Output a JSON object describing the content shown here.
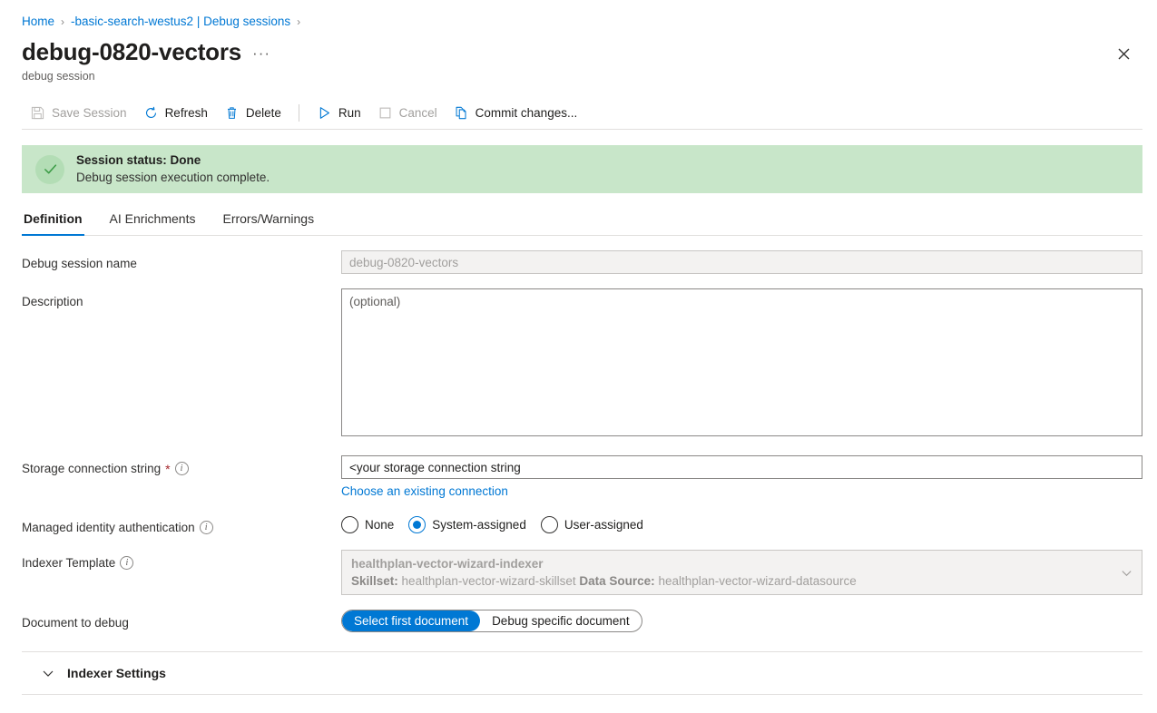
{
  "breadcrumb": {
    "items": [
      {
        "label": "Home"
      },
      {
        "label": "-basic-search-westus2 | Debug sessions"
      }
    ],
    "separator": "›"
  },
  "header": {
    "title": "debug-0820-vectors",
    "ellipsis": "···",
    "subtitle": "debug session",
    "close_label": "Close"
  },
  "toolbar": {
    "save_label": "Save Session",
    "refresh_label": "Refresh",
    "delete_label": "Delete",
    "run_label": "Run",
    "cancel_label": "Cancel",
    "commit_label": "Commit changes..."
  },
  "status": {
    "title": "Session status: Done",
    "description": "Debug session execution complete.",
    "bg_color": "#c8e6c9",
    "icon_color": "#107c10"
  },
  "tabs": [
    {
      "label": "Definition",
      "active": true
    },
    {
      "label": "AI Enrichments",
      "active": false
    },
    {
      "label": "Errors/Warnings",
      "active": false
    }
  ],
  "form": {
    "session_name": {
      "label": "Debug session name",
      "value": "debug-0820-vectors"
    },
    "description": {
      "label": "Description",
      "placeholder": "(optional)",
      "value": ""
    },
    "storage_connection": {
      "label": "Storage connection string",
      "required_marker": "*",
      "value": "<your storage connection string",
      "link_label": "Choose an existing connection"
    },
    "managed_identity": {
      "label": "Managed identity authentication",
      "options": [
        {
          "label": "None",
          "checked": false
        },
        {
          "label": "System-assigned",
          "checked": true
        },
        {
          "label": "User-assigned",
          "checked": false
        }
      ]
    },
    "indexer_template": {
      "label": "Indexer Template",
      "value": "healthplan-vector-wizard-indexer",
      "skillset_label": "Skillset:",
      "skillset_value": "healthplan-vector-wizard-skillset",
      "datasource_label": "Data Source:",
      "datasource_value": "healthplan-vector-wizard-datasource"
    },
    "document_to_debug": {
      "label": "Document to debug",
      "options": [
        {
          "label": "Select first document",
          "active": true
        },
        {
          "label": "Debug specific document",
          "active": false
        }
      ]
    }
  },
  "sections": [
    {
      "title": "Indexer Settings",
      "expanded": false
    }
  ],
  "colors": {
    "accent": "#0078d4",
    "required": "#a4262c",
    "success_bg": "#c8e6c9",
    "disabled_text": "#a19f9d"
  }
}
